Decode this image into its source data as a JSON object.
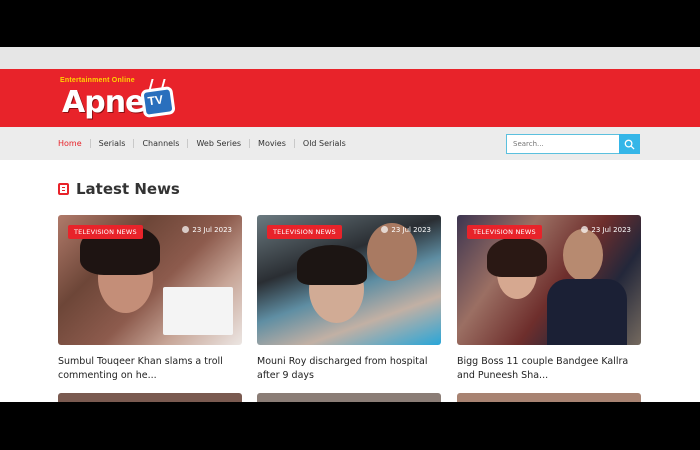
{
  "brand": {
    "tagline": "Entertainment Online",
    "name": "Apne",
    "tv": "TV"
  },
  "nav": {
    "items": [
      "Home",
      "Serials",
      "Channels",
      "Web Series",
      "Movies",
      "Old Serials"
    ]
  },
  "search": {
    "placeholder": "Search..."
  },
  "section": {
    "title": "Latest News"
  },
  "news": [
    {
      "category": "TELEVISION NEWS",
      "date": "23 Jul 2023",
      "headline": "Sumbul Touqeer Khan slams a troll commenting on he..."
    },
    {
      "category": "TELEVISION NEWS",
      "date": "23 Jul 2023",
      "headline": "Mouni Roy discharged from hospital after 9 days"
    },
    {
      "category": "TELEVISION NEWS",
      "date": "23 Jul 2023",
      "headline": "Bigg Boss 11 couple Bandgee Kallra and Puneesh Sha..."
    }
  ],
  "colors": {
    "accent": "#e8232a",
    "search_button": "#35b6e8"
  }
}
